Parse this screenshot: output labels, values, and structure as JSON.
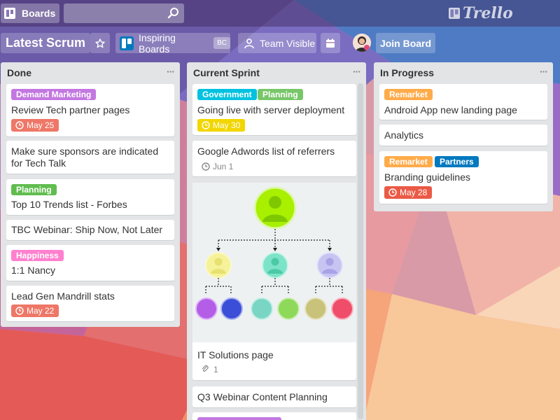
{
  "app": {
    "boards_label": "Boards",
    "search_placeholder": "",
    "logo_text": "Trello"
  },
  "board": {
    "title": "Latest Scrum",
    "org_name": "Inspiring Boards",
    "org_badge": "BC",
    "visibility": "Team Visible",
    "join_label": "Join Board"
  },
  "colors": {
    "purple": "#c377e0",
    "green": "#61bd4f",
    "teal": "#00c2e0",
    "orange": "#ffab4a",
    "blue": "#0079bf",
    "pink": "#ff80ce",
    "red": "#eb5a46",
    "yellow": "#f2d600",
    "due_soon": "#f2d600",
    "overdue": "#eb5a46"
  },
  "lists": [
    {
      "title": "Done",
      "cards": [
        {
          "labels": [
            {
              "text": "Demand Marketing",
              "color": "#c377e0"
            }
          ],
          "title": "Review Tech partner pages",
          "due": "May 25"
        },
        {
          "labels": [],
          "title": "Make sure sponsors are indicated for Tech Talk"
        },
        {
          "labels": [
            {
              "text": "Planning",
              "color": "#61bd4f"
            }
          ],
          "title": "Top 10 Trends list - Forbes"
        },
        {
          "labels": [],
          "title": "TBC Webinar: Ship Now, Not Later"
        },
        {
          "labels": [
            {
              "text": "Happiness",
              "color": "#ff80ce"
            }
          ],
          "title": "1:1 Nancy"
        },
        {
          "labels": [],
          "title": "Lead Gen Mandrill stats",
          "due": "May 22"
        }
      ]
    },
    {
      "title": "Current Sprint",
      "cards": [
        {
          "labels": [
            {
              "text": "Government",
              "color": "#00c2e0"
            },
            {
              "text": "Planning",
              "color": "#61bd4f"
            }
          ],
          "title": "Going live with server deployment",
          "due": "May 30"
        },
        {
          "labels": [],
          "title": "Google Adwords list of referrers",
          "due": "Jun 1"
        },
        {
          "labels": [],
          "title": "IT Solutions page",
          "attachments": "1"
        },
        {
          "labels": [],
          "title": "Q3 Webinar Content Planning"
        }
      ]
    },
    {
      "title": "In Progress",
      "cards": [
        {
          "labels": [
            {
              "text": "Remarket",
              "color": "#ffab4a"
            }
          ],
          "title": "Android App new landing page"
        },
        {
          "labels": [],
          "title": "Analytics"
        },
        {
          "labels": [
            {
              "text": "Remarket",
              "color": "#ffab4a"
            },
            {
              "text": "Partners",
              "color": "#0079bf"
            }
          ],
          "title": "Branding guidelines",
          "due": "May 28"
        }
      ]
    }
  ],
  "list_menu_glyph": "···"
}
